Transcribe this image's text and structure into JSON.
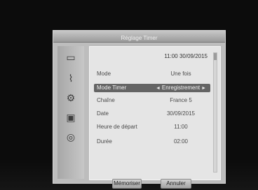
{
  "dialog": {
    "title": "Réglage Timer",
    "datetime": "11:00 30/09/2015"
  },
  "sidebar": {
    "icons": [
      "monitor-icon",
      "satellite-dish-icon",
      "gear-icon",
      "lock-icon",
      "globe-icon"
    ]
  },
  "fields": [
    {
      "label": "Mode",
      "value": "Une fois"
    },
    {
      "label": "Mode Timer",
      "value": "Enregistrement",
      "selected": true
    },
    {
      "label": "Chaîne",
      "value": "France 5"
    },
    {
      "label": "Date",
      "value": "30/09/2015"
    },
    {
      "label": "Heure de départ",
      "value": "11:00"
    },
    {
      "label": "Durée",
      "value": "02:00"
    }
  ],
  "buttons": {
    "save": "Mémoriser",
    "cancel": "Annuler"
  }
}
